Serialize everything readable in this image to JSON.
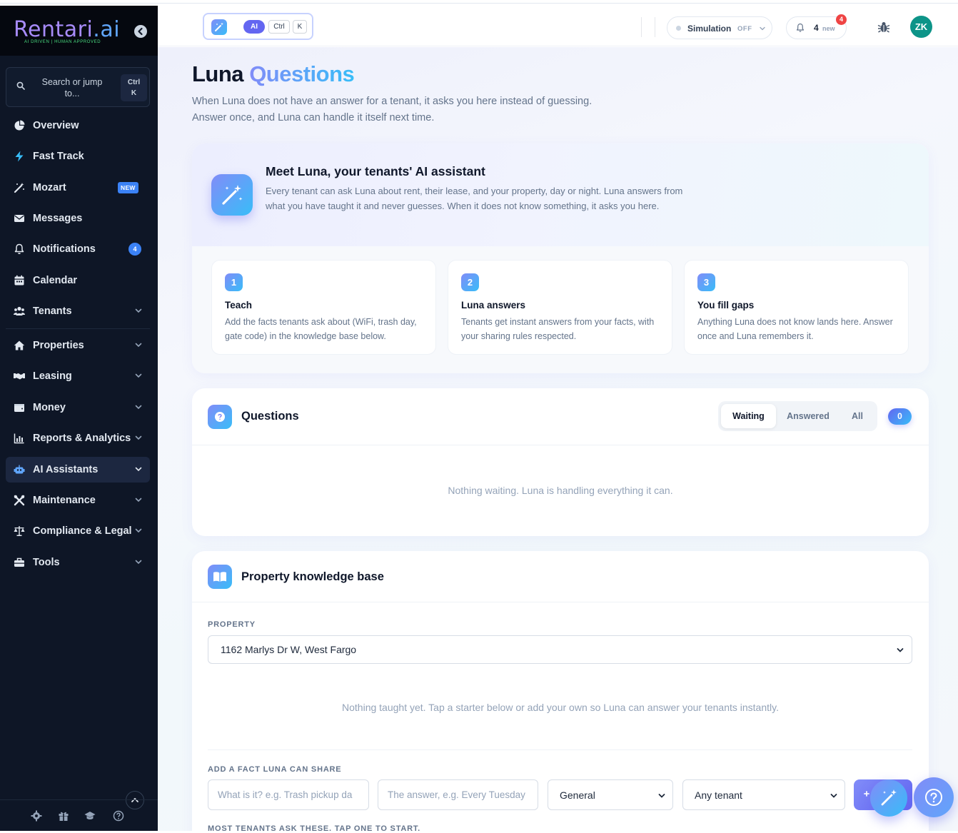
{
  "app": {
    "logo_brand": "Rentari",
    "logo_ai": ".ai",
    "logo_tagline": "AI DRIVEN | HUMAN APPROVED"
  },
  "sidebar": {
    "search_text": "Search or jump to...",
    "search_kbd_1": "Ctrl",
    "search_kbd_2": "K",
    "items": [
      {
        "label": "Overview",
        "icon": "chart-pie-icon"
      },
      {
        "label": "Fast Track",
        "icon": "bolt-icon"
      },
      {
        "label": "Mozart",
        "icon": "magic-wand-icon",
        "badge": "NEW"
      },
      {
        "label": "Messages",
        "icon": "envelope-icon"
      },
      {
        "label": "Notifications",
        "icon": "bell-icon",
        "count": "4"
      },
      {
        "label": "Calendar",
        "icon": "calendar-icon"
      },
      {
        "label": "Tenants",
        "icon": "users-icon"
      },
      {
        "label": "Properties",
        "icon": "home-icon"
      },
      {
        "label": "Leasing",
        "icon": "handshake-icon"
      },
      {
        "label": "Money",
        "icon": "wallet-icon"
      },
      {
        "label": "Reports & Analytics",
        "icon": "bar-chart-icon"
      },
      {
        "label": "AI Assistants",
        "icon": "robot-icon",
        "active": true
      },
      {
        "label": "Maintenance",
        "icon": "tools-icon"
      },
      {
        "label": "Compliance & Legal",
        "icon": "scale-icon"
      },
      {
        "label": "Tools",
        "icon": "toolbox-icon"
      }
    ],
    "footer_icons": [
      "gear-icon",
      "gift-icon",
      "graduation-cap-icon",
      "help-circle-icon"
    ]
  },
  "topbar": {
    "ai_label": "AI",
    "kbd_1": "Ctrl",
    "kbd_2": "K",
    "simulation_label": "Simulation",
    "simulation_value": "OFF",
    "notif_count": "4",
    "notif_new": "new",
    "notif_badge": "4",
    "avatar_initials": "ZK"
  },
  "page": {
    "title_plain": "Luna",
    "title_accent": "Questions",
    "subtitle_line1": "When Luna does not have an answer for a tenant, it asks you here instead of guessing.",
    "subtitle_line2": "Answer once, and Luna can handle it itself next time."
  },
  "intro": {
    "title": "Meet Luna, your tenants' AI assistant",
    "text": "Every tenant can ask Luna about rent, their lease, and your property, day or night. Luna answers from what you have taught it and never guesses. When it does not know something, it asks you here.",
    "steps": [
      {
        "num": "1",
        "title": "Teach",
        "desc": "Add the facts tenants ask about (WiFi, trash day, gate code) in the knowledge base below."
      },
      {
        "num": "2",
        "title": "Luna answers",
        "desc": "Tenants get instant answers from your facts, with your sharing rules respected."
      },
      {
        "num": "3",
        "title": "You fill gaps",
        "desc": "Anything Luna does not know lands here. Answer once and Luna remembers it."
      }
    ]
  },
  "questions": {
    "title": "Questions",
    "tabs": [
      "Waiting",
      "Answered",
      "All"
    ],
    "selected_tab": "Waiting",
    "count": "0",
    "empty": "Nothing waiting. Luna is handling everything it can."
  },
  "kb": {
    "title": "Property knowledge base",
    "property_label": "PROPERTY",
    "property_value": "1162 Marlys Dr W, West Fargo",
    "empty": "Nothing taught yet. Tap a starter below or add your own so Luna can answer your tenants instantly.",
    "add_label": "ADD A FACT LUNA CAN SHARE",
    "question_placeholder": "What is it? e.g. Trash pickup da",
    "answer_placeholder": "The answer, e.g. Every Tuesday",
    "category_value": "General",
    "audience_value": "Any tenant",
    "starters_label": "MOST TENANTS ASK THESE. TAP ONE TO START."
  },
  "colors": {
    "sidebar_bg": "#0e1626",
    "accent_indigo": "#6366f1",
    "accent_sky": "#38bdf8",
    "avatar": "#0d9488",
    "badge_red": "#ef4444"
  }
}
